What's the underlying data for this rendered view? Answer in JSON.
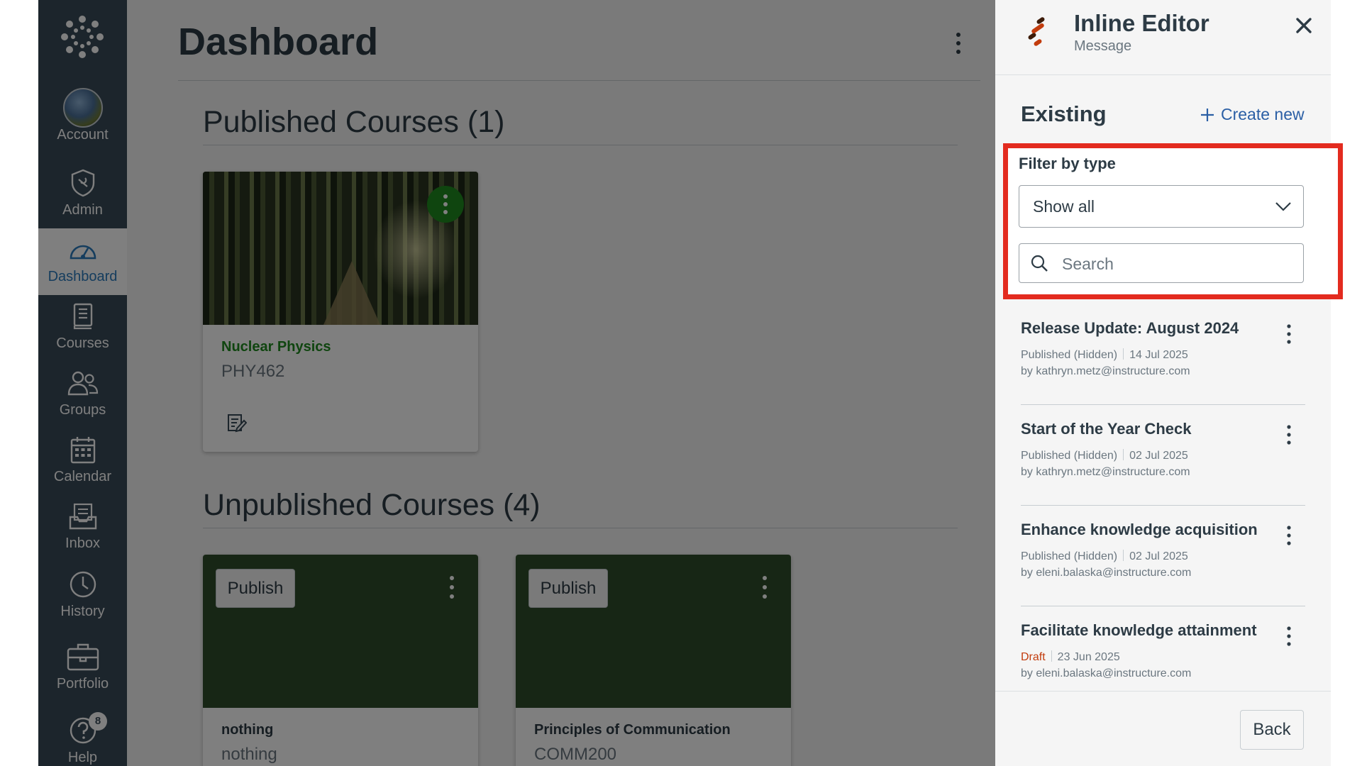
{
  "colors": {
    "nav_bg": "#394b58",
    "accent": "#2b7abc",
    "course_green": "#1e8a1e",
    "highlight": "#e32b1f",
    "draft": "#c23c0d"
  },
  "nav": {
    "items": [
      {
        "label": "Account",
        "icon": "avatar"
      },
      {
        "label": "Admin",
        "icon": "shield-icon"
      },
      {
        "label": "Dashboard",
        "icon": "dashboard-icon",
        "active": true
      },
      {
        "label": "Courses",
        "icon": "book-icon"
      },
      {
        "label": "Groups",
        "icon": "groups-icon"
      },
      {
        "label": "Calendar",
        "icon": "calendar-icon"
      },
      {
        "label": "Inbox",
        "icon": "inbox-icon"
      },
      {
        "label": "History",
        "icon": "clock-icon"
      },
      {
        "label": "Portfolio",
        "icon": "briefcase-icon"
      },
      {
        "label": "Help",
        "icon": "help-icon",
        "badge": "8"
      }
    ]
  },
  "main": {
    "title": "Dashboard",
    "published_heading": "Published Courses (1)",
    "unpublished_heading": "Unpublished Courses (4)",
    "published_courses": [
      {
        "name": "Nuclear Physics",
        "code": "PHY462"
      }
    ],
    "unpublished_courses": [
      {
        "publish_label": "Publish",
        "name": "nothing",
        "code": "nothing"
      },
      {
        "publish_label": "Publish",
        "name": "Principles of Communication",
        "code": "COMM200"
      }
    ]
  },
  "panel": {
    "title": "Inline Editor",
    "subtitle": "Message",
    "existing_label": "Existing",
    "create_new_label": "Create new",
    "filter_label": "Filter by type",
    "filter_value": "Show all",
    "search_placeholder": "Search",
    "items": [
      {
        "title": "Release Update: August 2024",
        "status": "Published (Hidden)",
        "date": "14 Jul 2025",
        "by": "by kathryn.metz@instructure.com"
      },
      {
        "title": "Start of the Year Check",
        "status": "Published (Hidden)",
        "date": "02 Jul 2025",
        "by": "by kathryn.metz@instructure.com"
      },
      {
        "title": "Enhance knowledge acquisition",
        "status": "Published (Hidden)",
        "date": "02 Jul 2025",
        "by": "by eleni.balaska@instructure.com"
      },
      {
        "title": "Facilitate knowledge attainment",
        "status": "Draft",
        "date": "23 Jun 2025",
        "by": "by eleni.balaska@instructure.com"
      }
    ],
    "back_label": "Back"
  }
}
